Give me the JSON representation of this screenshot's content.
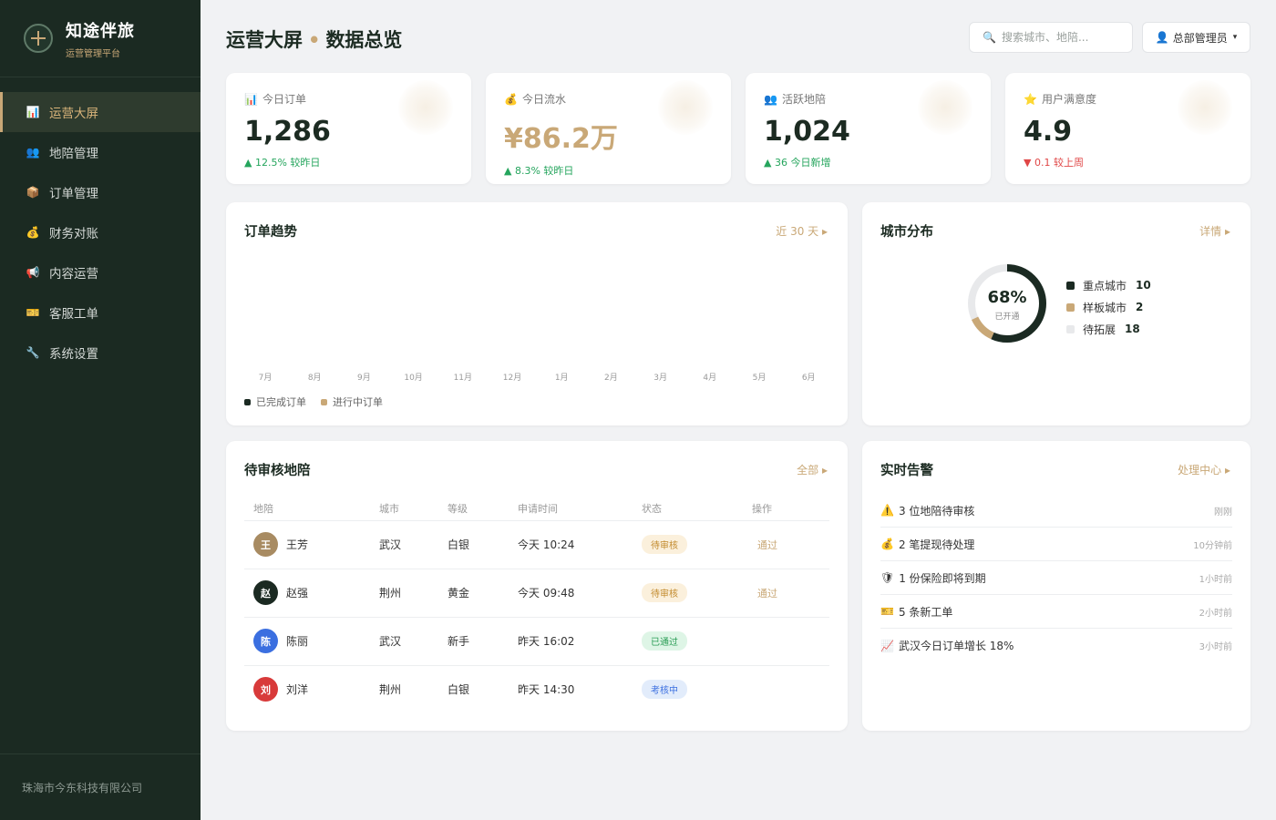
{
  "brand": {
    "title": "知途伴旅",
    "subtitle": "运营管理平台"
  },
  "nav": [
    {
      "label": "运营大屏",
      "icon": "bar-chart-icon",
      "glyph": "📊",
      "active": true
    },
    {
      "label": "地陪管理",
      "icon": "users-icon",
      "glyph": "👥"
    },
    {
      "label": "订单管理",
      "icon": "package-icon",
      "glyph": "📦"
    },
    {
      "label": "财务对账",
      "icon": "money-bag-icon",
      "glyph": "💰"
    },
    {
      "label": "内容运营",
      "icon": "megaphone-icon",
      "glyph": "📢"
    },
    {
      "label": "客服工单",
      "icon": "ticket-icon",
      "glyph": "🎫"
    },
    {
      "label": "系统设置",
      "icon": "wrench-icon",
      "glyph": "🔧"
    }
  ],
  "footer": "珠海市今东科技有限公司",
  "header": {
    "title_part1": "运营大屏",
    "separator": "•",
    "title_part2": "数据总览",
    "search_placeholder": "搜索城市、地陪...",
    "user_label": "总部管理员",
    "user_caret": "▾"
  },
  "stats": [
    {
      "label": "今日订单",
      "glyph": "📊",
      "value": "1,286",
      "delta": "▲ 12.5% 较昨日",
      "trend": "up"
    },
    {
      "label": "今日流水",
      "glyph": "💰",
      "value": "¥86.2万",
      "delta": "▲ 8.3% 较昨日",
      "trend": "up",
      "gold": true
    },
    {
      "label": "活跃地陪",
      "glyph": "👥",
      "value": "1,024",
      "delta": "▲ 36 今日新增",
      "trend": "up"
    },
    {
      "label": "用户满意度",
      "glyph": "⭐",
      "value": "4.9",
      "delta": "▼ 0.1 较上周",
      "trend": "down"
    }
  ],
  "trend": {
    "title": "订单趋势",
    "range_link": "近 30 天 ▸",
    "months": [
      "7月",
      "8月",
      "9月",
      "10月",
      "11月",
      "12月",
      "1月",
      "2月",
      "3月",
      "4月",
      "5月",
      "6月"
    ],
    "legend": [
      {
        "label": "已完成订单",
        "color": "#1b2a22"
      },
      {
        "label": "进行中订单",
        "color": "#c9a877"
      }
    ]
  },
  "city": {
    "title": "城市分布",
    "link": "详情 ▸",
    "center_pct": "68%",
    "center_label": "已开通",
    "items": [
      {
        "label": "重点城市",
        "value": 10,
        "color": "#1b2a22"
      },
      {
        "label": "样板城市",
        "value": 2,
        "color": "#c9a877"
      },
      {
        "label": "待拓展",
        "value": 18,
        "color": "#e8e9eb"
      }
    ]
  },
  "pending": {
    "title": "待审核地陪",
    "link": "全部 ▸",
    "columns": [
      "地陪",
      "城市",
      "等级",
      "申请时间",
      "状态",
      "操作"
    ],
    "rows": [
      {
        "initial": "王",
        "name": "王芳",
        "avatar_color": "#a88b62",
        "city": "武汉",
        "level": "白银",
        "time": "今天 10:24",
        "status": "待审核",
        "status_bg": "#fbf0dc",
        "status_fg": "#c28a2c",
        "action": "通过"
      },
      {
        "initial": "赵",
        "name": "赵强",
        "avatar_color": "#1b2a22",
        "city": "荆州",
        "level": "黄金",
        "time": "今天 09:48",
        "status": "待审核",
        "status_bg": "#fbf0dc",
        "status_fg": "#c28a2c",
        "action": "通过"
      },
      {
        "initial": "陈",
        "name": "陈丽",
        "avatar_color": "#3b6fe0",
        "city": "武汉",
        "level": "新手",
        "time": "昨天 16:02",
        "status": "已通过",
        "status_bg": "#def5e6",
        "status_fg": "#2a9d55",
        "action": ""
      },
      {
        "initial": "刘",
        "name": "刘洋",
        "avatar_color": "#d83a3a",
        "city": "荆州",
        "level": "白银",
        "time": "昨天 14:30",
        "status": "考核中",
        "status_bg": "#e2ecfb",
        "status_fg": "#3b6fe0",
        "action": ""
      }
    ]
  },
  "alerts": {
    "title": "实时告警",
    "link": "处理中心 ▸",
    "items": [
      {
        "glyph": "⚠️",
        "icon": "warning-icon",
        "text": "3 位地陪待审核",
        "time": "刚刚"
      },
      {
        "glyph": "💰",
        "icon": "money-bag-icon",
        "text": "2 笔提现待处理",
        "time": "10分钟前"
      },
      {
        "glyph": "🛡",
        "icon": "shield-icon",
        "text": "1 份保险即将到期",
        "time": "1小时前"
      },
      {
        "glyph": "🎫",
        "icon": "ticket-icon",
        "text": "5 条新工单",
        "time": "2小时前"
      },
      {
        "glyph": "📈",
        "icon": "chart-up-icon",
        "text": "武汉今日订单增长 18%",
        "time": "3小时前"
      }
    ]
  }
}
